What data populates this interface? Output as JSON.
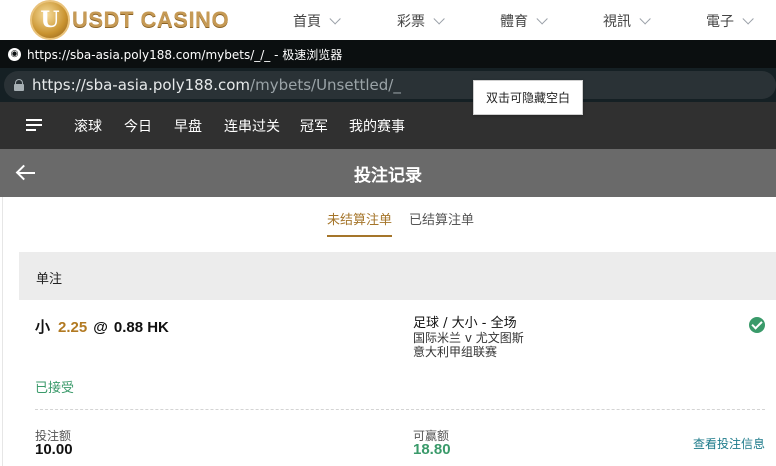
{
  "site_nav": {
    "logo_letter": "U",
    "logo_text": "USDT CASINO",
    "items": [
      {
        "label": "首頁"
      },
      {
        "label": "彩票"
      },
      {
        "label": "體育"
      },
      {
        "label": "視訊"
      },
      {
        "label": "電子"
      }
    ]
  },
  "browser": {
    "title": "https://sba-asia.poly188.com/mybets/_/_ - 极速浏览器",
    "url_host": "https://sba-asia.poly188.com",
    "url_path": "/mybets/Unsettled/_",
    "tooltip": "双击可隐藏空白"
  },
  "sports_nav": {
    "tabs": [
      "滚球",
      "今日",
      "早盘",
      "连串过关",
      "冠军",
      "我的赛事"
    ]
  },
  "page": {
    "title": "投注记录",
    "tabs": {
      "unsettled": "未结算注单",
      "settled": "已结算注单"
    },
    "section": "单注"
  },
  "bet": {
    "selection": "小",
    "handicap": "2.25",
    "at": "@",
    "odds": "0.88 HK",
    "market": "足球 / 大小 - 全场",
    "match": "国际米兰 v 尤文图斯",
    "league": "意大利甲组联赛",
    "status": "已接受",
    "stake_label": "投注额",
    "stake": "10.00",
    "win_label": "可赢额",
    "win": "18.80",
    "details_link": "查看投注信息"
  },
  "colors": {
    "accent_gold": "#a5752a",
    "accepted_green": "#3a9a6a",
    "header_gray": "#6a6a6a",
    "nav_dark": "#303030"
  }
}
